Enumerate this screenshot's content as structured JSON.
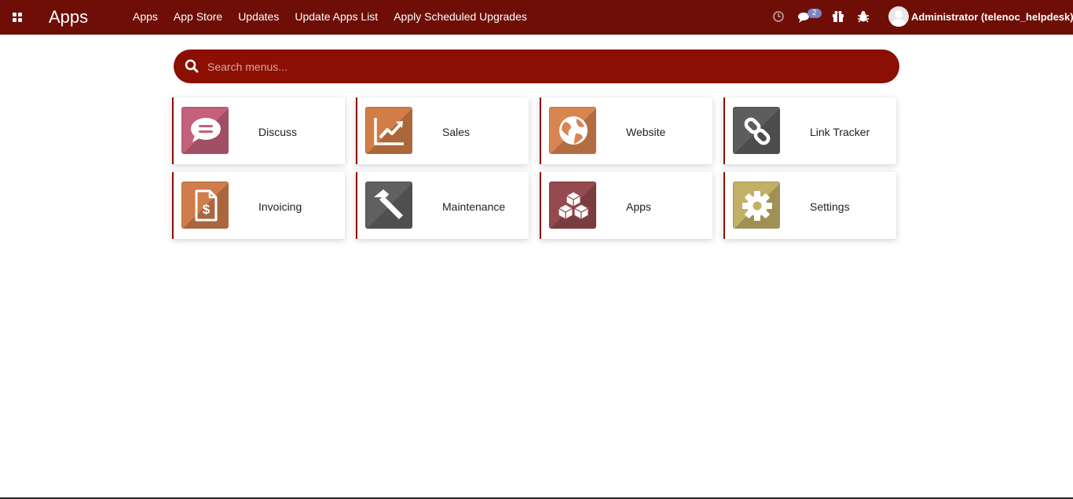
{
  "topbar": {
    "brand": "Apps",
    "menu": [
      "Apps",
      "App Store",
      "Updates",
      "Update Apps List",
      "Apply Scheduled Upgrades"
    ],
    "systray": {
      "icons": [
        "clock-icon",
        "chat-icon",
        "gift-icon",
        "bug-icon"
      ],
      "messages_count": "2"
    },
    "user": "Administrator (telenoc_helpdesk)"
  },
  "search": {
    "placeholder": "Search menus..."
  },
  "apps": [
    {
      "label": "Discuss",
      "icon": "discuss-icon",
      "color": "#c4607a"
    },
    {
      "label": "Sales",
      "icon": "sales-chart-icon",
      "color": "#d17d45"
    },
    {
      "label": "Website",
      "icon": "globe-icon",
      "color": "#d98552"
    },
    {
      "label": "Link Tracker",
      "icon": "link-icon",
      "color": "#5d5d5d"
    },
    {
      "label": "Invoicing",
      "icon": "invoice-icon",
      "color": "#cf7d4c"
    },
    {
      "label": "Maintenance",
      "icon": "hammer-icon",
      "color": "#606060"
    },
    {
      "label": "Apps",
      "icon": "cubes-icon",
      "color": "#944a4e"
    },
    {
      "label": "Settings",
      "icon": "gear-icon",
      "color": "#c2b067"
    }
  ],
  "colors": {
    "topbar": "#6e0e06",
    "accent": "#8b0f02",
    "badge": "#7b85c3"
  }
}
